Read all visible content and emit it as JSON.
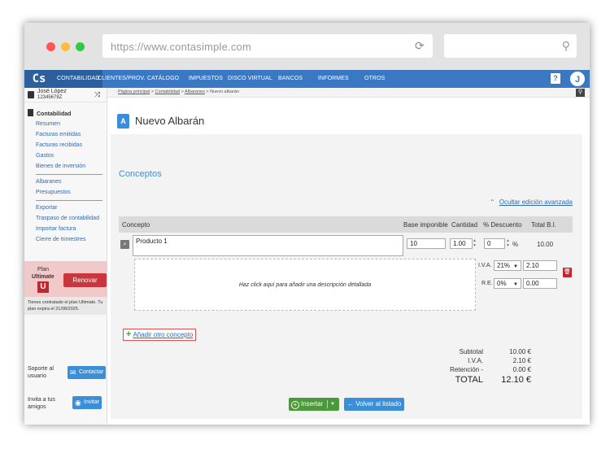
{
  "browser": {
    "url": "https://www.contasimple.com"
  },
  "topnav": {
    "logo": "Cs",
    "items": [
      "CONTABILIDAD",
      "CLIENTES/PROV.",
      "CATÁLOGO",
      "IMPUESTOS",
      "DISCO VIRTUAL",
      "BANCOS",
      "INFORMES",
      "OTROS"
    ],
    "help": "?",
    "avatar": "J"
  },
  "sidebar": {
    "user_name": "José López",
    "user_id": "12345678Z",
    "section": "Contabilidad",
    "group1": [
      "Resumen",
      "Facturas emitidas",
      "Facturas recibidas",
      "Gastos",
      "Bienes de inversión"
    ],
    "group2": [
      "Albaranes",
      "Presupuestos"
    ],
    "group3": [
      "Exportar",
      "Traspaso de contabilidad",
      "Importar factura",
      "Cierre de trimestres"
    ],
    "plan_label": "Plan",
    "plan_name": "Ultimate",
    "plan_badge": "U",
    "renew": "Renovar",
    "plan_note": "Tienes contratado el plan Ultimate. Tu plan expira el 21/08/2025.",
    "support_label": "Soporte al usuario",
    "contact": "Contactar",
    "invite_label": "Invita a tus amigos",
    "invite": "Invitar"
  },
  "breadcrumb": {
    "home": "Página principal",
    "sep": ">",
    "section": "Contabilidad",
    "list": "Albaranes",
    "current": "Nuevo albarán"
  },
  "page": {
    "icon_letter": "A",
    "title": "Nuevo Albarán",
    "concepts_title": "Conceptos",
    "adv_link": "Ocultar edición avanzada",
    "headers": {
      "concepto": "Concepto",
      "base": "Base imponible",
      "cantidad": "Cantidad",
      "descuento": "% Descuento",
      "total": "Total B.I."
    },
    "row": {
      "concepto": "Producto 1",
      "base": "10",
      "cantidad": "1.00",
      "descuento": "0",
      "pct": "%",
      "total": "10.00"
    },
    "desc_placeholder": "Haz click aquí para añadir una descripción detallada",
    "iva_label": "I.V.A.",
    "iva_rate": "21%",
    "iva_value": "2.10",
    "re_label": "R.E.",
    "re_rate": "0%",
    "re_value": "0.00",
    "add_concept": "Añadir otro concepto",
    "summary": {
      "subtotal_label": "Subtotal",
      "subtotal": "10.00 €",
      "iva_label": "I.V.A.",
      "iva": "2.10 €",
      "ret_label": "Retención -",
      "ret": "0.00 €",
      "total_label": "TOTAL",
      "total": "12.10 €"
    },
    "insert": "Insertar",
    "back": "Volver al listado"
  }
}
